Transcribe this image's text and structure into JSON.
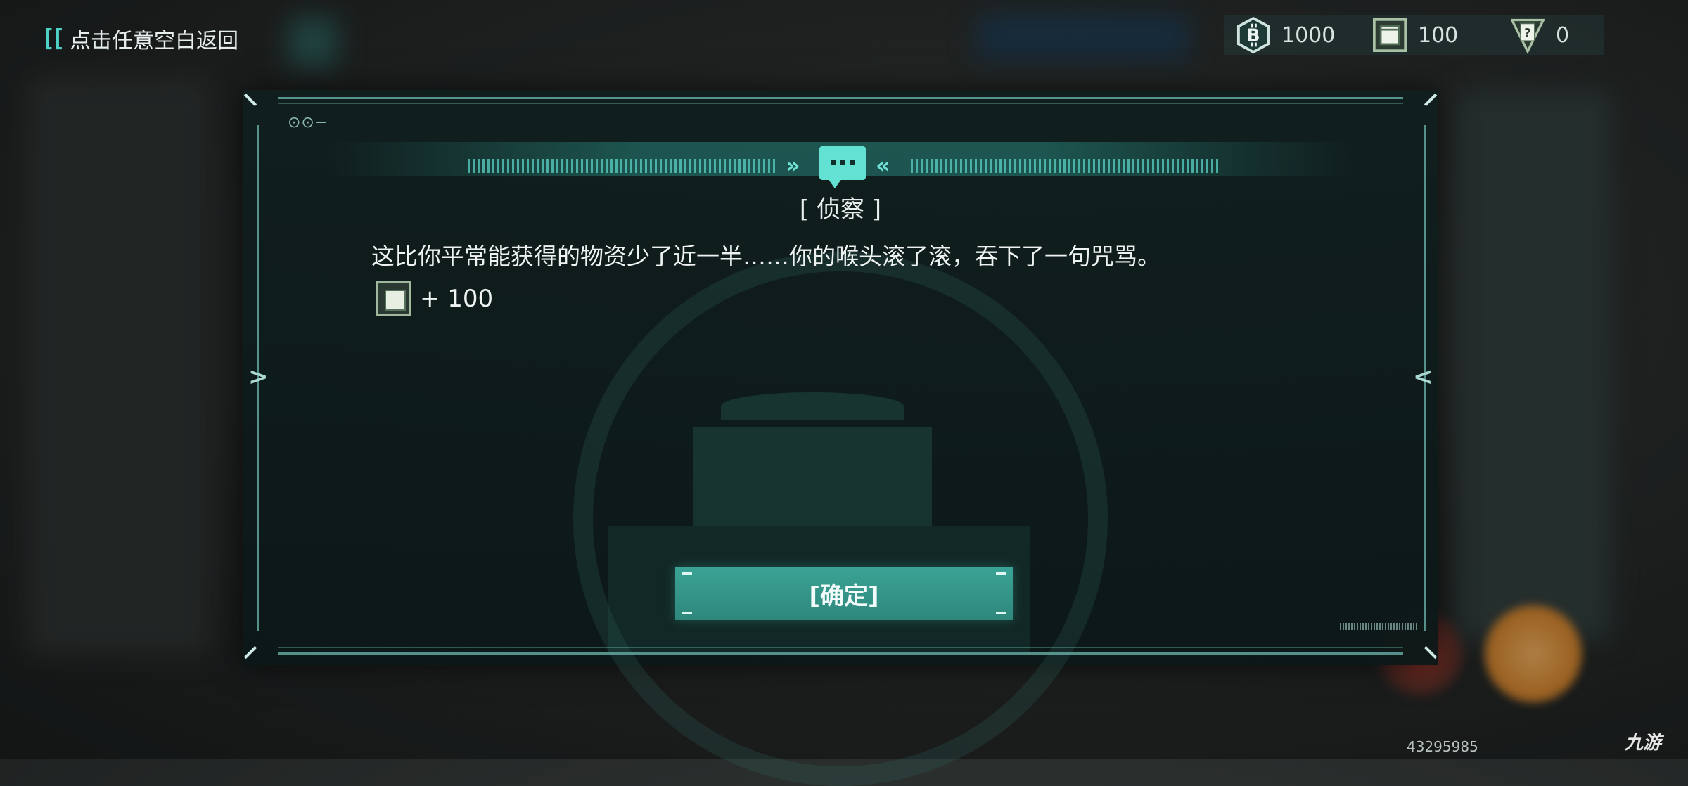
{
  "topbar": {
    "back_label": "点击任意空白返回",
    "resources": [
      {
        "icon": "bitcoin-coin-icon",
        "value": "1000"
      },
      {
        "icon": "supply-crate-icon",
        "value": "100"
      },
      {
        "icon": "mystery-card-icon",
        "value": "0"
      }
    ]
  },
  "dialog": {
    "icon": "chat-bubble-icon",
    "title": "[ 侦察 ]",
    "message": "这比你平常能获得的物资少了近一半……你的喉头滚了滚，吞下了一句咒骂。",
    "reward": {
      "icon": "supply-crate-icon",
      "value": "+ 100"
    },
    "confirm_label": "[确定]"
  },
  "footer": {
    "code": "43295985",
    "watermark": "九游"
  },
  "colors": {
    "accent": "#4fd2c6",
    "button": "#3aa395",
    "panel": "#10201f"
  }
}
